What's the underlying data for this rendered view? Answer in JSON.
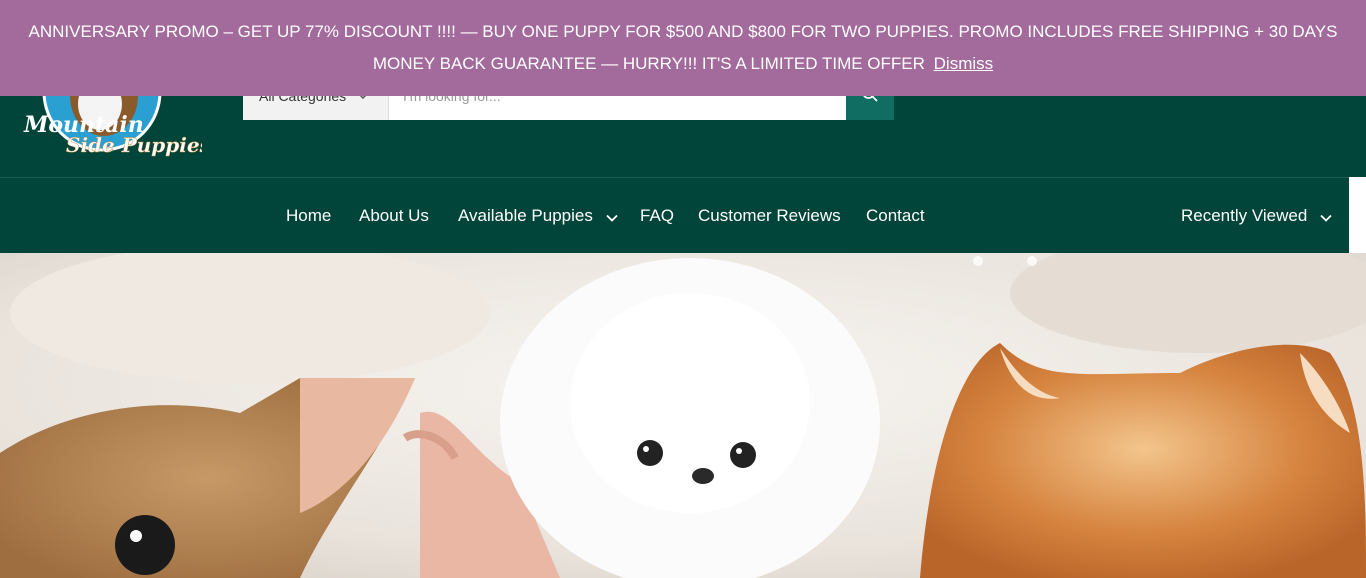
{
  "promo": {
    "text": "ANNIVERSARY PROMO – GET UP 77% DISCOUNT !!!! — BUY ONE PUPPY FOR $500 AND $800 FOR TWO PUPPIES. PROMO INCLUDES FREE SHIPPING + 30 DAYS MONEY BACK GUARANTEE — HURRY!!! IT'S A LIMITED TIME OFFER",
    "dismiss_label": "Dismiss"
  },
  "logo": {
    "line1": "Mountain",
    "line2": "Side Puppies"
  },
  "search": {
    "category_label": "All Categories",
    "placeholder": "I'm looking for..."
  },
  "nav": {
    "items": [
      {
        "label": "Home",
        "active": true
      },
      {
        "label": "About Us"
      },
      {
        "label": "Available Puppies",
        "has_dropdown": true
      },
      {
        "label": "FAQ"
      },
      {
        "label": "Customer Reviews"
      },
      {
        "label": "Contact"
      }
    ],
    "recently_viewed_label": "Recently Viewed"
  },
  "colors": {
    "header_bg": "#00443a",
    "promo_bg": "#a36a9c",
    "search_button": "#0f6e61"
  },
  "hero": {
    "image": "puppies-banner (chihuahua, white pomeranian, orange pomeranian)"
  }
}
